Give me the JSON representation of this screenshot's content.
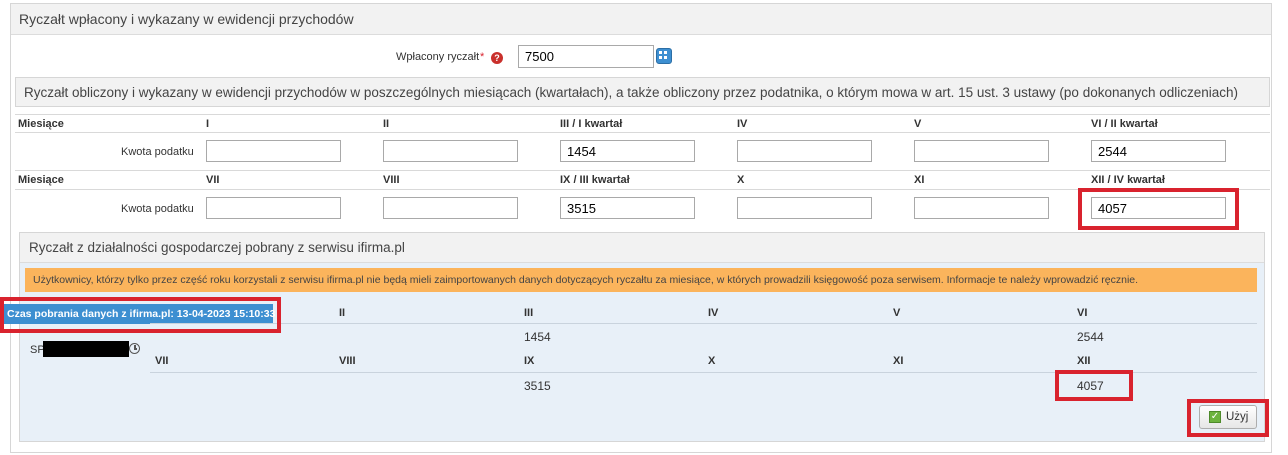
{
  "section_title": "Ryczałt wpłacony i wykazany w ewidencji przychodów",
  "paid": {
    "label": "Wpłacony ryczałt",
    "required_mark": "*",
    "value": "7500"
  },
  "computed": {
    "title": "Ryczałt obliczony i wykazany w ewidencji przychodów w poszczególnych miesiącach (kwartałach), a także obliczony przez podatnika, o którym mowa w art. 15 ust. 3 ustawy (po dokonanych odliczeniach)",
    "months_label": "Miesiące",
    "amount_label": "Kwota podatku",
    "row1_months": [
      "I",
      "II",
      "III / I kwartał",
      "IV",
      "V",
      "VI / II kwartał"
    ],
    "row1_values": [
      "",
      "",
      "1454",
      "",
      "",
      "2544"
    ],
    "row2_months": [
      "VII",
      "VIII",
      "IX / III kwartał",
      "X",
      "XI",
      "XII / IV kwartał"
    ],
    "row2_values": [
      "",
      "",
      "3515",
      "",
      "",
      "4057"
    ]
  },
  "ifirma": {
    "title": "Ryczałt z działalności gospodarczej pobrany z serwisu ifirma.pl",
    "warning": "Użytkownicy, którzy tylko przez część roku korzystali z serwisu ifirma.pl nie będą mieli zaimportowanych danych dotyczących ryczałtu za miesiące, w których prowadzili księgowość poza serwisem. Informacje te należy wprowadzić ręcznie.",
    "fetch_time": "Czas pobrania danych z ifirma.pl: 13-04-2023 15:10:33",
    "company_prefix": "SP",
    "row1_months": [
      "II",
      "III",
      "IV",
      "V",
      "VI"
    ],
    "row1_values": [
      "1454",
      "2544"
    ],
    "row2_months": [
      "VII",
      "VIII",
      "IX",
      "X",
      "XI",
      "XII"
    ],
    "row2_values": [
      "3515",
      "4057"
    ],
    "use_button": "Użyj"
  },
  "icons": [
    "help-icon",
    "calculator-icon",
    "clock-icon",
    "checkmark-icon"
  ],
  "colors": {
    "highlight": "#d9232e",
    "warning_bg": "#fbb45c",
    "fetch_badge": "#3d8fd1"
  }
}
